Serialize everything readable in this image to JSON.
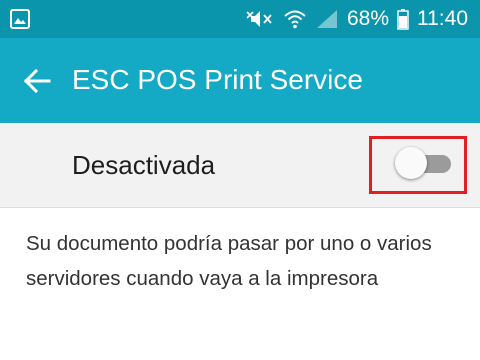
{
  "status_bar": {
    "battery_percent": "68%",
    "time": "11:40",
    "icons": [
      "image-notification-icon",
      "mute-icon",
      "wifi-icon",
      "signal-icon",
      "battery-icon"
    ]
  },
  "app_bar": {
    "title": "ESC POS Print Service",
    "back_icon": "arrow-left-icon"
  },
  "toggle": {
    "label": "Desactivada",
    "state": "off"
  },
  "description": "Su documento podría pasar por uno o varios servidores cuando vaya a la impresora",
  "colors": {
    "status_bar": "#0a95ad",
    "app_bar": "#14a9c4",
    "highlight": "#e02020",
    "row_bg": "#f2f2f2"
  }
}
